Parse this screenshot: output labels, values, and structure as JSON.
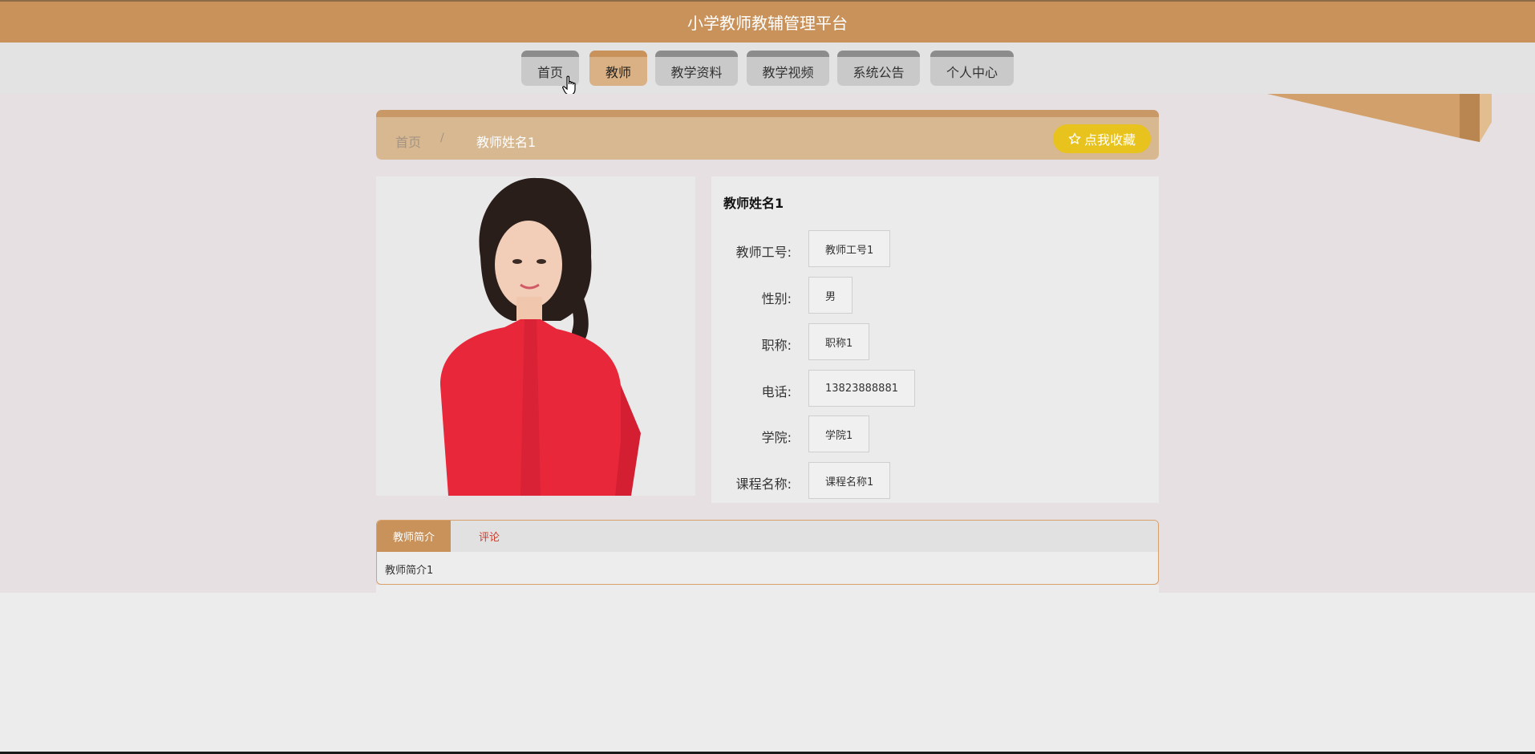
{
  "header": {
    "site_title": "小学教师教辅管理平台",
    "brand_color": "#c8925a"
  },
  "nav": {
    "items": [
      {
        "label": "首页"
      },
      {
        "label": "教师"
      },
      {
        "label": "教学资料"
      },
      {
        "label": "教学视频"
      },
      {
        "label": "系统公告"
      },
      {
        "label": "个人中心"
      }
    ],
    "active_label": "教师"
  },
  "breadcrumb": {
    "home": "首页",
    "separator": "/",
    "current": "教师姓名1"
  },
  "favorite_button": {
    "label": "点我收藏",
    "icon": "star-outline-icon",
    "color": "#e8c21d"
  },
  "teacher": {
    "name": "教师姓名1",
    "fields": [
      {
        "label": "教师工号:",
        "value": "教师工号1"
      },
      {
        "label": "性别:",
        "value": "男"
      },
      {
        "label": "职称:",
        "value": "职称1"
      },
      {
        "label": "电话:",
        "value": "13823888881"
      },
      {
        "label": "学院:",
        "value": "学院1"
      },
      {
        "label": "课程名称:",
        "value": "课程名称1"
      }
    ]
  },
  "tabs": {
    "items": [
      {
        "label": "教师简介"
      },
      {
        "label": "评论"
      }
    ],
    "active_content": "教师简介1"
  }
}
